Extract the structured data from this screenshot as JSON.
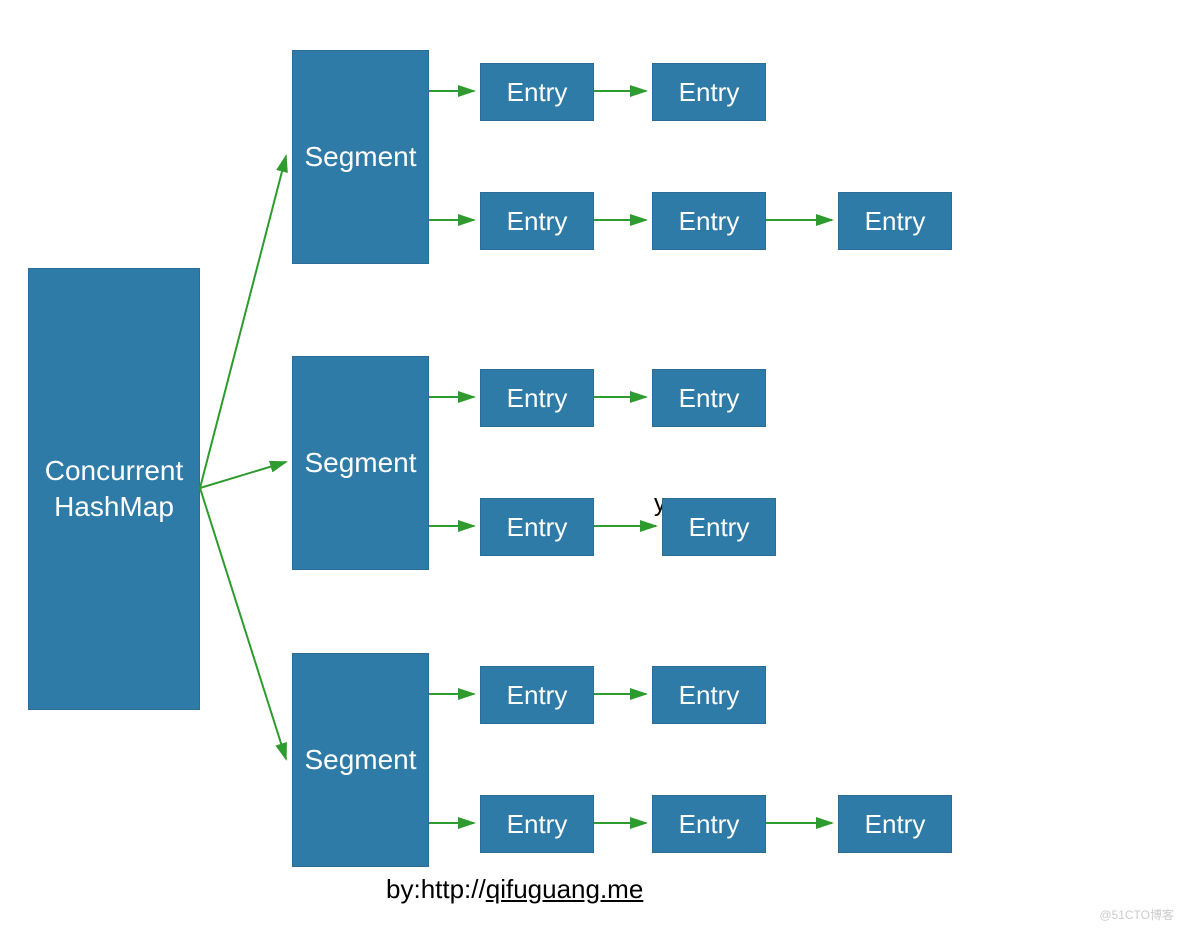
{
  "root": {
    "line1": "Concurrent",
    "line2": "HashMap"
  },
  "segments": [
    {
      "label": "Segment",
      "rows": [
        {
          "entries": [
            "Entry",
            "Entry"
          ]
        },
        {
          "entries": [
            "Entry",
            "Entry",
            "Entry"
          ]
        }
      ]
    },
    {
      "label": "Segment",
      "rows": [
        {
          "entries": [
            "Entry",
            "Entry"
          ]
        },
        {
          "entries": [
            "Entry",
            "Entry"
          ],
          "stray": "y"
        }
      ]
    },
    {
      "label": "Segment",
      "rows": [
        {
          "entries": [
            "Entry",
            "Entry"
          ]
        },
        {
          "entries": [
            "Entry",
            "Entry",
            "Entry"
          ]
        }
      ]
    }
  ],
  "attribution": {
    "prefix": "by:",
    "url_scheme": "http://",
    "url_rest": "qifuguang.me"
  },
  "watermark": "@51CTO博客",
  "colors": {
    "box": "#2f7ba7",
    "arrow": "#2e9b2e"
  }
}
